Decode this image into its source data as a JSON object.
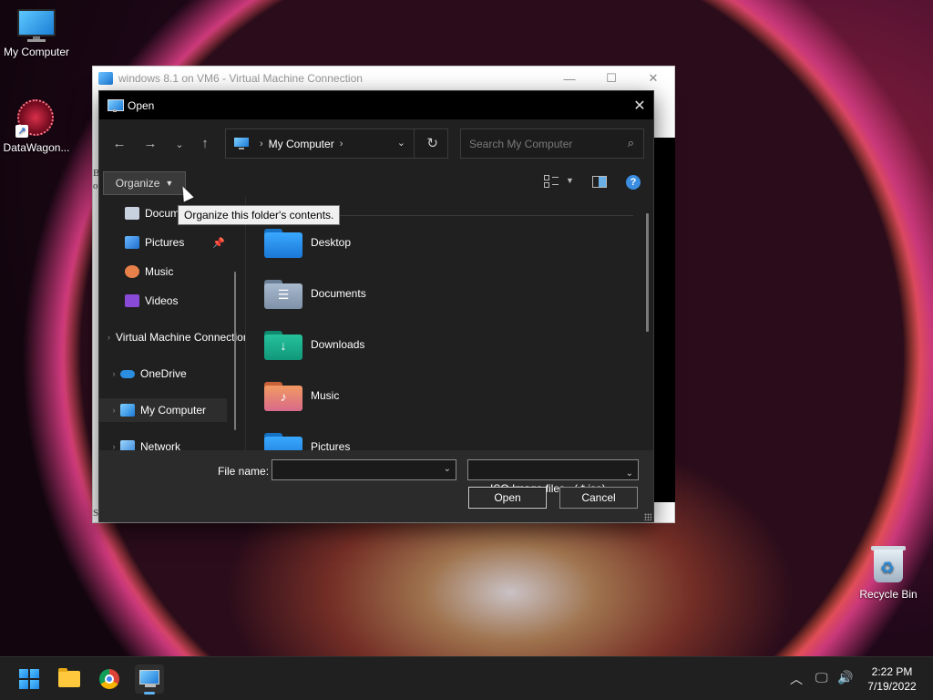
{
  "desktop": {
    "icons": [
      {
        "label": "My Computer",
        "icon": "computer-icon"
      },
      {
        "label": "DataWagon...",
        "icon": "datawagon-icon"
      },
      {
        "label": "Recycle Bin",
        "icon": "recycle-bin-icon"
      }
    ]
  },
  "vm_window": {
    "title": "windows 8.1 on VM6 - Virtual Machine Connection",
    "side_text": "B\no",
    "bottom_text": "S"
  },
  "dialog": {
    "title": "Open",
    "address": {
      "location": "My Computer"
    },
    "search": {
      "placeholder": "Search My Computer"
    },
    "toolbar": {
      "organize_label": "Organize"
    },
    "tooltip": "Organize this folder's contents.",
    "nav_items": [
      {
        "label": "Documents",
        "icon": "documents-icon",
        "pinned": false
      },
      {
        "label": "Pictures",
        "icon": "pictures-icon",
        "pinned": true
      },
      {
        "label": "Music",
        "icon": "music-icon",
        "pinned": false
      },
      {
        "label": "Videos",
        "icon": "videos-icon",
        "pinned": false
      },
      {
        "label": "Virtual Machine Connection",
        "icon": "vm-connection-icon",
        "expandable": true
      },
      {
        "label": "OneDrive",
        "icon": "onedrive-icon",
        "expandable": true
      },
      {
        "label": "My Computer",
        "icon": "computer-icon",
        "expandable": true,
        "selected": true
      },
      {
        "label": "Network",
        "icon": "network-icon",
        "expandable": true
      }
    ],
    "folders": [
      {
        "label": "Desktop",
        "icon": "desktop-folder-icon",
        "color": "#1e90e8"
      },
      {
        "label": "Documents",
        "icon": "documents-folder-icon",
        "color": "#8aa0b8"
      },
      {
        "label": "Downloads",
        "icon": "downloads-folder-icon",
        "color": "#18a88a"
      },
      {
        "label": "Music",
        "icon": "music-folder-icon",
        "color": "#e8804a"
      },
      {
        "label": "Pictures",
        "icon": "pictures-folder-icon",
        "color": "#1e90e8"
      }
    ],
    "footer": {
      "file_name_label": "File name:",
      "file_name_value": "",
      "file_type": "ISO Image files   ( *.iso)",
      "open_label": "Open",
      "cancel_label": "Cancel"
    }
  },
  "taskbar": {
    "apps": [
      "start",
      "file-explorer",
      "chrome",
      "virtual-machine-connection"
    ],
    "time": "2:22 PM",
    "date": "7/19/2022"
  }
}
